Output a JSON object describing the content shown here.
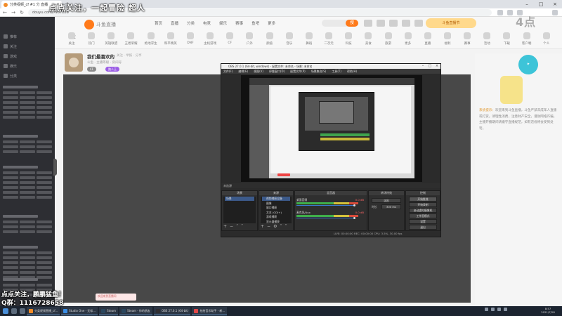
{
  "browser": {
    "tab_title": "分类视频_cf #1 分 直播",
    "url": "douyu.com/7957228",
    "overlay_title": "点点关注，一起冒险 超人"
  },
  "douyu": {
    "logo_text": "斗鱼直播",
    "nav": [
      "首页",
      "直播",
      "分类",
      "电竞",
      "娱乐",
      "赛事",
      "鱼吧",
      "更多"
    ],
    "search_button": "搜",
    "mascot_text": "斗鱼直播节",
    "watermark": "4点",
    "badge_count": "12",
    "categories": [
      "关注",
      "热门",
      "英雄联盟",
      "王者荣耀",
      "绝地求生",
      "和平精英",
      "DNF",
      "主机游戏",
      "CF",
      "户外",
      "颜值",
      "音乐",
      "舞蹈",
      "二次元",
      "科技",
      "美食",
      "旅游",
      "更多",
      "直播",
      "福利",
      "赛事",
      "活动",
      "下载",
      "客户端",
      "个人"
    ]
  },
  "sidebar": {
    "items": [
      "推荐",
      "关注",
      "游戏",
      "娱乐",
      "分类"
    ]
  },
  "room": {
    "title": "我们最喜欢的",
    "meta": "关注 · 举报 · 分享",
    "sub": "斗鱼 · 主播等级 · 房间号",
    "tags": [
      "CF",
      "路人王"
    ]
  },
  "obs": {
    "title": "OBS 27.0.1 (64-bit, windows) - 配置文件: 未命名 - 场景: 未命名",
    "menu": [
      "文件(F)",
      "编辑(E)",
      "视图(V)",
      "停靠窗口(D)",
      "配置文件(P)",
      "场景集合(S)",
      "工具(T)",
      "帮助(H)"
    ],
    "status_row": "未选源",
    "docks": {
      "scenes": "场景",
      "sources": "来源",
      "mixer": "混音器",
      "transitions": "转场特效",
      "controls": "控制"
    },
    "scene_items": [
      "场景"
    ],
    "source_items": [
      "视频捕获设备",
      "图像",
      "窗口捕获",
      "文本 (GDI+)",
      "游戏捕获",
      "显示器捕获"
    ],
    "mixer_items": [
      {
        "name": "桌面音频",
        "db": "0.0 dB"
      },
      {
        "name": "麦克风/Aux",
        "db": "0.0 dB"
      }
    ],
    "transition_label": "淡出",
    "duration_label": "时长",
    "duration_value": "300 ms",
    "controls": [
      "开始推流",
      "开始录制",
      "启动虚拟摄像机",
      "工作室模式",
      "设置",
      "退出"
    ],
    "bottom_status": "LIVE: 00:00:00   REC: 00:00:00   CPU: 3.5%, 30.00 fps"
  },
  "notice": {
    "lead": "系统提示：",
    "text": "欢迎来到斗鱼直播，斗鱼严禁未成年人直播或打赏。请理性消费，注意财产安全，谨防网络诈骗。主播开播期间请遵守直播规范，如有违规将会受到处罚。"
  },
  "chat": {
    "box": "欢迎来到直播间"
  },
  "overlay": {
    "line1": "点点关注，鹏鹏猛鱼！",
    "line2": "Q群：1116728658"
  },
  "taskbar": {
    "apps": [
      {
        "label": "分类视频直播_cf...",
        "color": "#f28c28"
      },
      {
        "label": "Studio One - 无标...",
        "color": "#3a8ee6"
      },
      {
        "label": "Steam",
        "color": "#2a475e"
      },
      {
        "label": "Steam - 你的朋友",
        "color": "#2a475e"
      },
      {
        "label": "OBS 27.0.1 (64-bit)",
        "color": "#302e31"
      },
      {
        "label": "拍拍音乐助手 - 新...",
        "color": "#e04848"
      }
    ],
    "time": "8:57",
    "date": "2021/7/28"
  }
}
